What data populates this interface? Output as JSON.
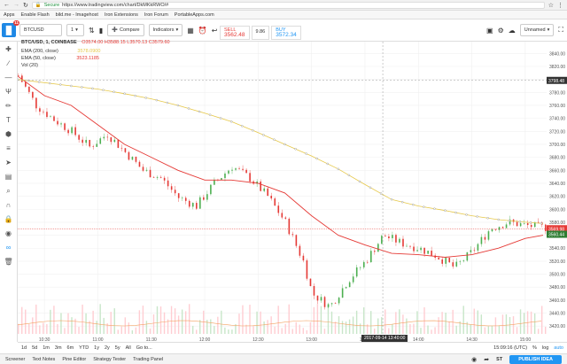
{
  "browser": {
    "secure_label": "Secure",
    "url": "https://www.tradingview.com/chart/DkMKkRWO/#"
  },
  "bookmarks": [
    "Apps",
    "Enable Flash",
    "bild.me - Imagehost",
    "Iron Extensions",
    "Iron Forum",
    "PortableApps.com"
  ],
  "toolbar": {
    "symbol": "BTCUSD",
    "interval": "1",
    "compare_label": "Compare",
    "indicators_label": "Indicators",
    "unnamed_label": "Unnamed",
    "notification_count": "11"
  },
  "legend": {
    "title": "BTC/USD, 1, COINBASE",
    "open": "3574.00",
    "high": "3588.15",
    "low": "3570.13",
    "close": "3579.60",
    "ema200_label": "EMA (200, close)",
    "ema200_value": "3578.0900",
    "ema50_label": "EMA (50, close)",
    "ema50_value": "3523.1185",
    "vol_label": "Vol (20)"
  },
  "sell_buy": {
    "sell_label": "SELL",
    "sell_value": "3562.48",
    "spread": "9.86",
    "buy_label": "BUY",
    "buy_value": "3572.34"
  },
  "crosshair_time": "2017-09-14 13:40:00",
  "price_tags": {
    "cursor": "3798.48",
    "last": "3569.98",
    "ema": "3560.44"
  },
  "bottom": {
    "ranges": [
      "1d",
      "5d",
      "1m",
      "3m",
      "6m",
      "YTD",
      "1y",
      "2y",
      "5y",
      "All",
      "Go to..."
    ],
    "clock": "15:09:16 (UTC)",
    "scale_options": [
      "%",
      "log",
      "auto"
    ]
  },
  "panels": [
    "Screener",
    "Text Notes",
    "Pine Editor",
    "Strategy Tester",
    "Trading Panel"
  ],
  "publish_label": "PUBLISH IDEA",
  "colors": {
    "up": "#4caf50",
    "down": "#e53935",
    "ema50": "#e53935",
    "ema200": "#e6c84a",
    "accent": "#2196f3"
  },
  "chart_data": {
    "type": "candlestick",
    "title": "BTC/USD, 1, COINBASE",
    "y_ticks": [
      3420,
      3440,
      3460,
      3480,
      3500,
      3520,
      3540,
      3560,
      3580,
      3600,
      3620,
      3640,
      3660,
      3680,
      3700,
      3720,
      3740,
      3760,
      3780,
      3800,
      3820,
      3840
    ],
    "x_ticks": [
      "10:30",
      "11:00",
      "11:30",
      "12:00",
      "12:30",
      "13:00",
      "13:30",
      "14:00",
      "14:30",
      "15:00"
    ],
    "ylim": [
      3408,
      3850
    ],
    "close_path": [
      [
        "10:15",
        3806
      ],
      [
        "10:25",
        3760
      ],
      [
        "10:35",
        3738
      ],
      [
        "10:45",
        3720
      ],
      [
        "10:55",
        3696
      ],
      [
        "11:05",
        3716
      ],
      [
        "11:15",
        3688
      ],
      [
        "11:25",
        3660
      ],
      [
        "11:35",
        3648
      ],
      [
        "11:45",
        3618
      ],
      [
        "11:55",
        3605
      ],
      [
        "12:05",
        3640
      ],
      [
        "12:15",
        3666
      ],
      [
        "12:25",
        3648
      ],
      [
        "12:35",
        3620
      ],
      [
        "12:45",
        3580
      ],
      [
        "12:55",
        3520
      ],
      [
        "13:00",
        3470
      ],
      [
        "13:10",
        3450
      ],
      [
        "13:20",
        3490
      ],
      [
        "13:30",
        3520
      ],
      [
        "13:40",
        3560
      ],
      [
        "13:50",
        3548
      ],
      [
        "14:00",
        3540
      ],
      [
        "14:10",
        3528
      ],
      [
        "14:20",
        3510
      ],
      [
        "14:30",
        3535
      ],
      [
        "14:40",
        3570
      ],
      [
        "14:50",
        3580
      ],
      [
        "15:00",
        3575
      ],
      [
        "15:10",
        3572
      ]
    ],
    "ema50_path": [
      [
        "10:15",
        3805
      ],
      [
        "10:30",
        3775
      ],
      [
        "10:45",
        3760
      ],
      [
        "11:00",
        3730
      ],
      [
        "11:15",
        3700
      ],
      [
        "11:30",
        3680
      ],
      [
        "11:45",
        3660
      ],
      [
        "12:00",
        3645
      ],
      [
        "12:15",
        3645
      ],
      [
        "12:30",
        3640
      ],
      [
        "12:45",
        3625
      ],
      [
        "13:00",
        3590
      ],
      [
        "13:15",
        3560
      ],
      [
        "13:30",
        3545
      ],
      [
        "13:45",
        3532
      ],
      [
        "14:00",
        3530
      ],
      [
        "14:15",
        3526
      ],
      [
        "14:30",
        3530
      ],
      [
        "14:45",
        3540
      ],
      [
        "15:00",
        3555
      ],
      [
        "15:10",
        3560
      ]
    ],
    "ema200_path": [
      [
        "10:15",
        3800
      ],
      [
        "10:45",
        3790
      ],
      [
        "11:00",
        3785
      ],
      [
        "11:15",
        3778
      ],
      [
        "11:30",
        3770
      ],
      [
        "11:45",
        3760
      ],
      [
        "12:00",
        3748
      ],
      [
        "12:15",
        3735
      ],
      [
        "12:30",
        3718
      ],
      [
        "12:45",
        3700
      ],
      [
        "13:00",
        3682
      ],
      [
        "13:15",
        3662
      ],
      [
        "13:30",
        3638
      ],
      [
        "13:45",
        3615
      ],
      [
        "14:00",
        3605
      ],
      [
        "14:15",
        3598
      ],
      [
        "14:30",
        3590
      ],
      [
        "14:45",
        3584
      ],
      [
        "15:00",
        3580
      ],
      [
        "15:10",
        3578
      ]
    ]
  }
}
